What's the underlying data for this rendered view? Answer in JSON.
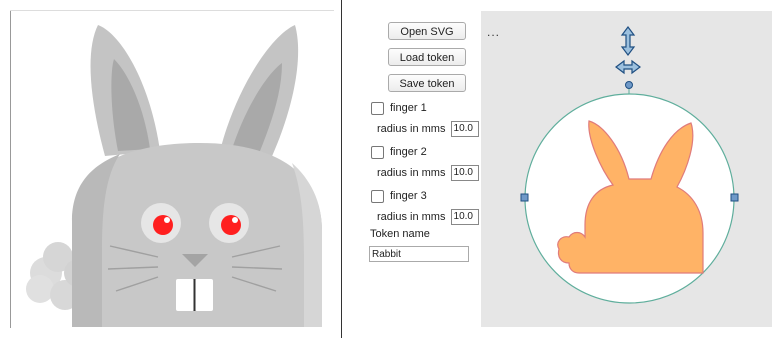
{
  "toolbar": {
    "open_svg_label": "Open SVG",
    "load_token_label": "Load token",
    "save_token_label": "Save token"
  },
  "fingers": [
    {
      "label": "finger 1",
      "checked": false,
      "radius_label": "radius in mms",
      "radius_value": "10.0"
    },
    {
      "label": "finger 2",
      "checked": false,
      "radius_label": "radius in mms",
      "radius_value": "10.0"
    },
    {
      "label": "finger 3",
      "checked": false,
      "radius_label": "radius in mms",
      "radius_value": "10.0"
    }
  ],
  "token": {
    "name_label": "Token name",
    "name_value": "Rabbit"
  },
  "canvas": {
    "menu_label": "...",
    "token_fill": "#ffb366",
    "circle_stroke": "#5fae9c"
  },
  "preview": {
    "eye_color": "#ff1f1f",
    "fur_color": "#c8c8c8"
  }
}
